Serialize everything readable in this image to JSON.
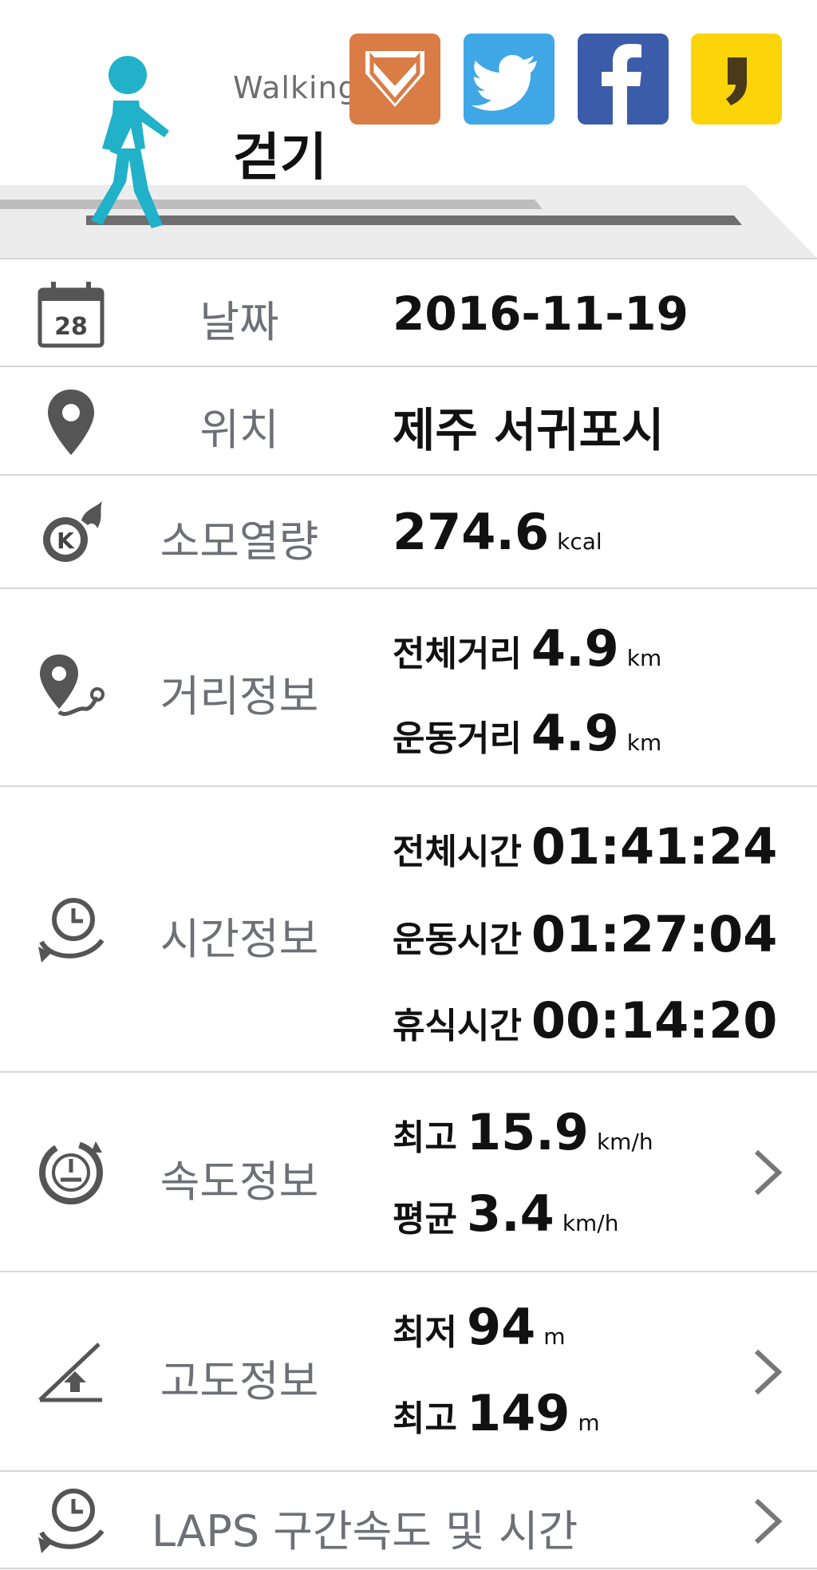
{
  "header": {
    "activity_en": "Walking",
    "activity_ko": "걷기",
    "share": [
      {
        "name": "band",
        "icon": "band-icon",
        "color": "#d97c45"
      },
      {
        "name": "twitter",
        "icon": "twitter-bird-icon",
        "color": "#3fa7e6"
      },
      {
        "name": "facebook",
        "icon": "facebook-f-icon",
        "color": "#3b5ca8"
      },
      {
        "name": "kakaostory",
        "icon": "kakaostory-icon",
        "color": "#fbd40a"
      }
    ],
    "accent_color": "#21b1c9"
  },
  "rows": {
    "date": {
      "label": "날짜",
      "value": "2016-11-19",
      "icon": "calendar-icon",
      "calendar_day": "28"
    },
    "location": {
      "label": "위치",
      "value": "제주 서귀포시",
      "icon": "location-pin-icon"
    },
    "calories": {
      "label": "소모열량",
      "value": "274.6",
      "unit": "kcal",
      "icon": "calorie-burn-icon",
      "badge": "K"
    },
    "distance": {
      "label": "거리정보",
      "icon": "distance-route-icon",
      "total_label": "전체거리",
      "total_value": "4.9",
      "total_unit": "km",
      "exercise_label": "운동거리",
      "exercise_value": "4.9",
      "exercise_unit": "km"
    },
    "time": {
      "label": "시간정보",
      "icon": "time-cycle-icon",
      "total_label": "전체시간",
      "total_value": "01:41:24",
      "exercise_label": "운동시간",
      "exercise_value": "01:27:04",
      "rest_label": "휴식시간",
      "rest_value": "00:14:20"
    },
    "speed": {
      "label": "속도정보",
      "icon": "speedometer-icon",
      "max_label": "최고",
      "max_value": "15.9",
      "max_unit": "km/h",
      "avg_label": "평균",
      "avg_value": "3.4",
      "avg_unit": "km/h"
    },
    "altitude": {
      "label": "고도정보",
      "icon": "altitude-slope-icon",
      "min_label": "최저",
      "min_value": "94",
      "min_unit": "m",
      "max_label": "최고",
      "max_value": "149",
      "max_unit": "m"
    },
    "laps": {
      "label": "LAPS 구간속도 및 시간",
      "icon": "laps-clock-icon"
    }
  }
}
